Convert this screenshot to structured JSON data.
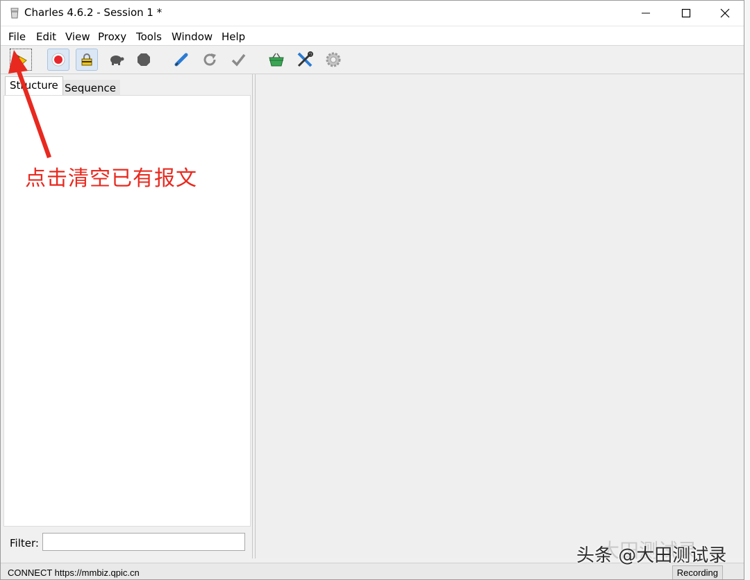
{
  "window": {
    "title": "Charles 4.6.2 - Session 1 *"
  },
  "menu": {
    "items": [
      "File",
      "Edit",
      "View",
      "Proxy",
      "Tools",
      "Window",
      "Help"
    ]
  },
  "toolbar": {
    "buttons": [
      {
        "icon": "broom-clear-icon"
      },
      {
        "icon": "record-icon"
      },
      {
        "icon": "ssl-proxy-lock-icon"
      },
      {
        "icon": "throttle-turtle-icon"
      },
      {
        "icon": "breakpoint-stop-icon"
      },
      {
        "icon": "compose-pen-icon"
      },
      {
        "icon": "repeat-icon"
      },
      {
        "icon": "validate-check-icon"
      },
      {
        "icon": "basket-icon"
      },
      {
        "icon": "tools-icon"
      },
      {
        "icon": "settings-gear-icon"
      }
    ]
  },
  "left_panel": {
    "tabs": [
      "Structure",
      "Sequence"
    ],
    "active_tab": "Structure",
    "filter_label": "Filter:",
    "filter_value": ""
  },
  "status": {
    "text": "CONNECT https://mmbiz.qpic.cn",
    "recording": "Recording"
  },
  "annotation": {
    "text": "点击清空已有报文",
    "color": "#e8291f"
  },
  "watermark": {
    "text": "头条 @大田测试录",
    "ghost": "大田测试录"
  },
  "colors": {
    "record_red": "#e8262d",
    "basket_green": "#3aa655",
    "tools_blue": "#2b7bd3"
  }
}
